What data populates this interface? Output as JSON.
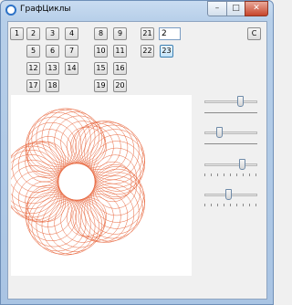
{
  "window": {
    "title": "ГрафЦиклы",
    "minimize_glyph": "–",
    "maximize_glyph": "□",
    "close_glyph": "✕"
  },
  "colors": {
    "curve": "#e8643a"
  },
  "buttons": {
    "b1": "1",
    "b2": "2",
    "b3": "3",
    "b4": "4",
    "b5": "5",
    "b6": "6",
    "b7": "7",
    "b8": "8",
    "b9": "9",
    "b10": "10",
    "b11": "11",
    "b12": "12",
    "b13": "13",
    "b14": "14",
    "b15": "15",
    "b16": "16",
    "b17": "17",
    "b18": "18",
    "b19": "19",
    "b20": "20",
    "b21": "21",
    "b22": "22",
    "b23": "23",
    "clear": "C"
  },
  "input": {
    "value": "2"
  },
  "sliders": [
    {
      "name": "slider-1",
      "level": 0.7,
      "ticks": "line"
    },
    {
      "name": "slider-2",
      "level": 0.25,
      "ticks": "line"
    },
    {
      "name": "slider-3",
      "level": 0.75,
      "ticks": "dots"
    },
    {
      "name": "slider-4",
      "level": 0.45,
      "ticks": "dots"
    }
  ]
}
